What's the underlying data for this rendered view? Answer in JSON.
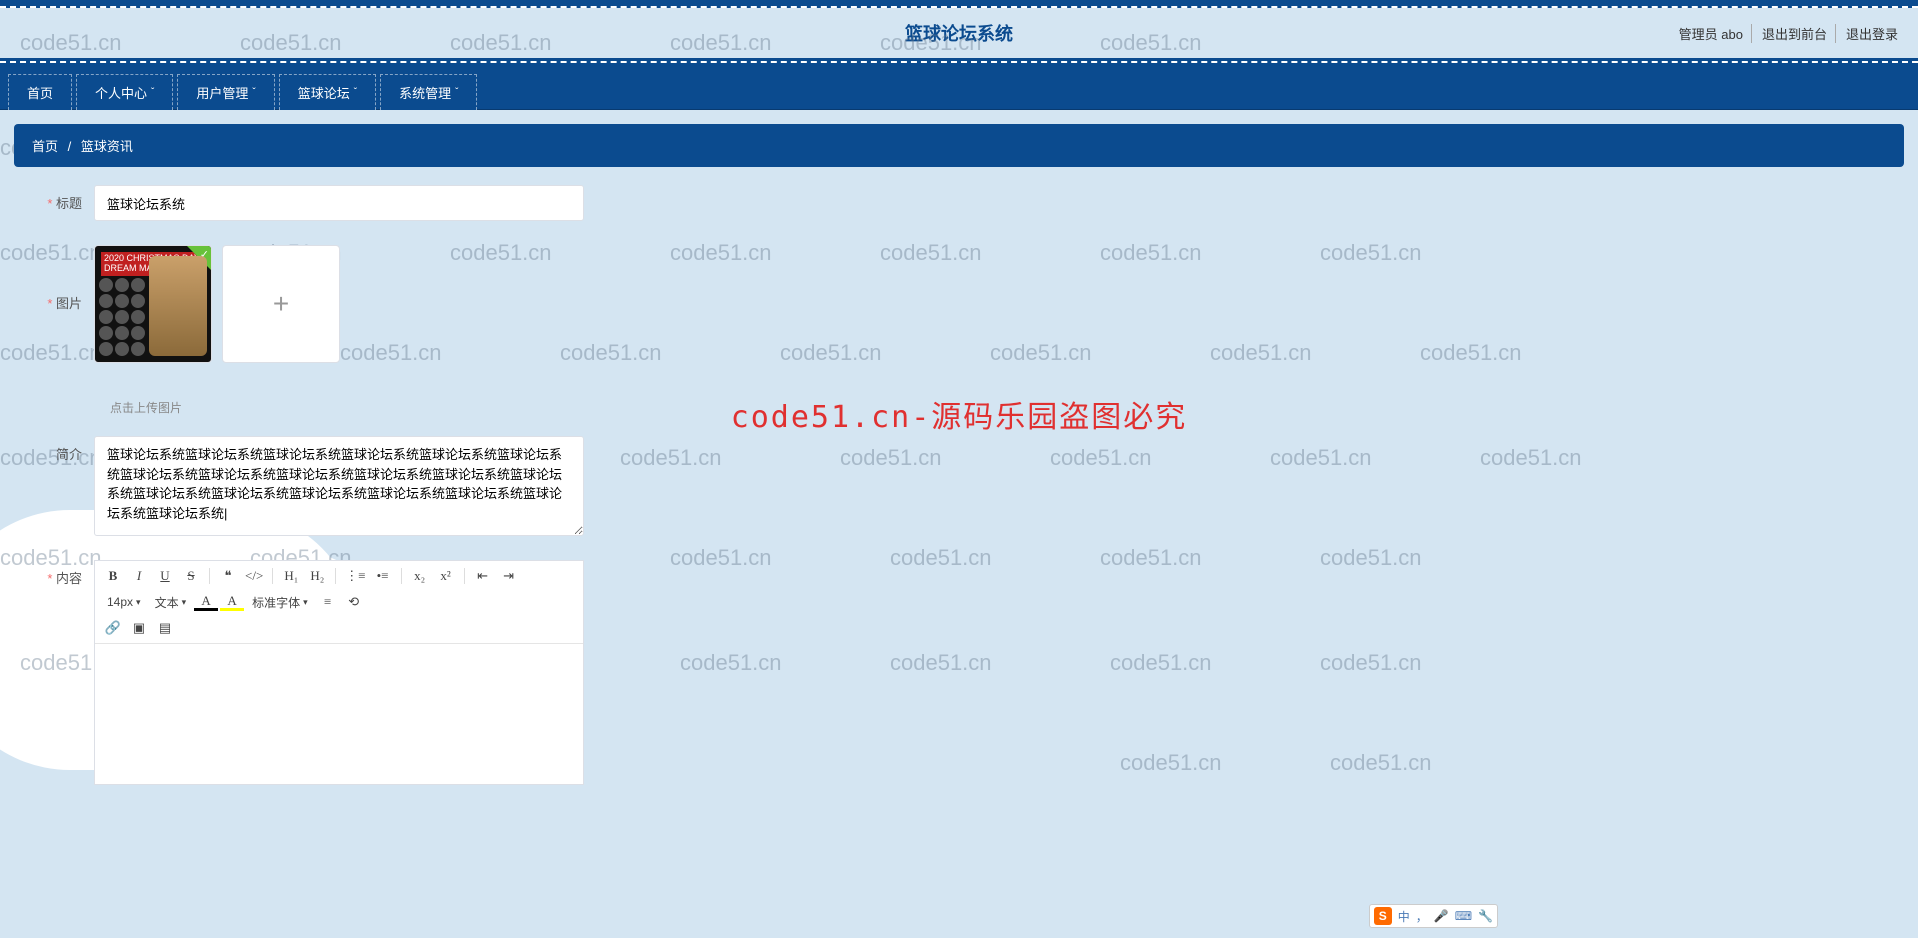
{
  "header": {
    "title": "篮球论坛系统",
    "admin_label": "管理员 abo",
    "exit_front": "退出到前台",
    "logout": "退出登录"
  },
  "nav": {
    "home": "首页",
    "personal": "个人中心",
    "users": "用户管理",
    "forum": "篮球论坛",
    "system": "系统管理"
  },
  "breadcrumb": {
    "home": "首页",
    "sep": "/",
    "current": "篮球资讯"
  },
  "form": {
    "title_label": "标题",
    "title_value": "篮球论坛系统",
    "image_label": "图片",
    "thumb_banner_line1": "2020 CHRISTMAS DAY",
    "thumb_banner_line2": "DREAM MATCHUPS",
    "upload_hint": "点击上传图片",
    "intro_label": "简介",
    "intro_value": "篮球论坛系统篮球论坛系统篮球论坛系统篮球论坛系统篮球论坛系统篮球论坛系统篮球论坛系统篮球论坛系统篮球论坛系统篮球论坛系统篮球论坛系统篮球论坛系统篮球论坛系统篮球论坛系统篮球论坛系统篮球论坛系统篮球论坛系统篮球论坛系统篮球论坛系统|",
    "content_label": "内容"
  },
  "editor": {
    "font_size": "14px",
    "font_type": "文本",
    "font_family": "标准字体"
  },
  "watermark": {
    "text": "code51.cn",
    "center": "code51.cn-源码乐园盗图必究"
  },
  "ime": {
    "zh": "中",
    "punct": "，",
    "mic": "🎤",
    "kbd": "⌨",
    "tool": "🔧"
  }
}
